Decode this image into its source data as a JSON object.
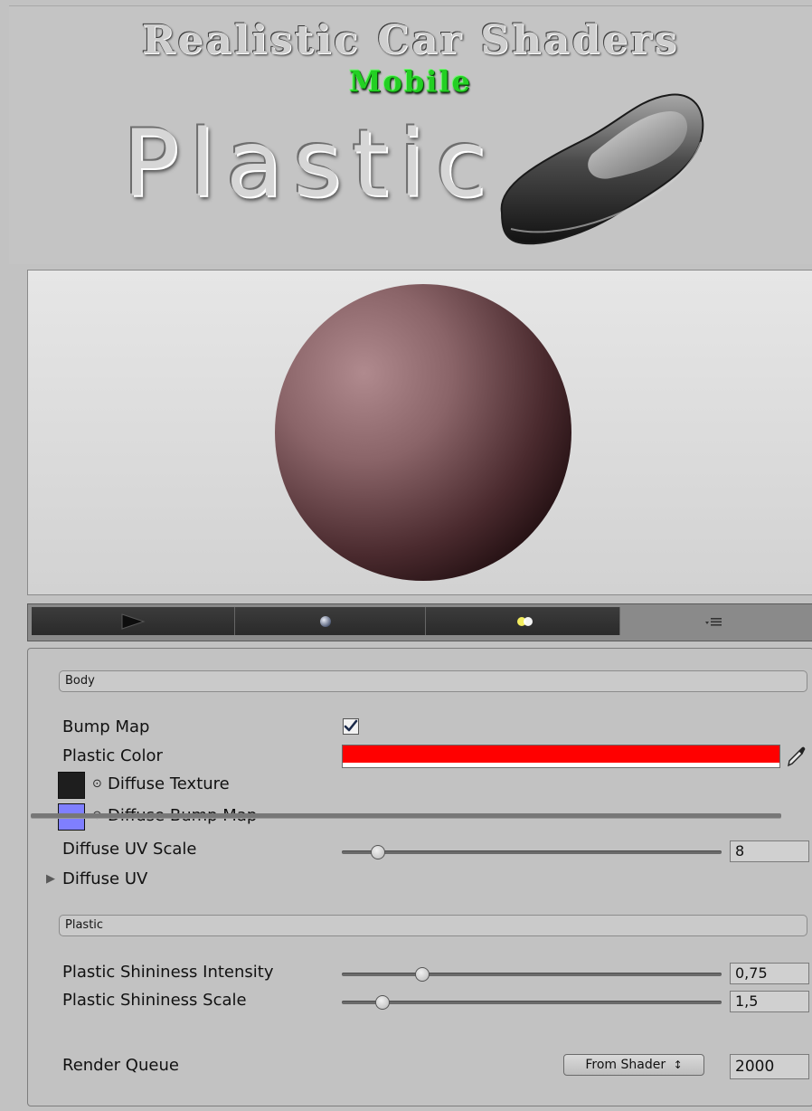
{
  "banner": {
    "title": "Realistic Car Shaders",
    "subtitle": "Mobile",
    "material_name": "Plastic",
    "icon": "car-body-icon"
  },
  "preview": {
    "sphere_colors": [
      "#b08a8e",
      "#4a2a2e",
      "#0d0506"
    ]
  },
  "toolbar": {
    "icons": [
      "play-icon",
      "sphere-icon",
      "light-icon",
      "menu-icon"
    ]
  },
  "sections": {
    "body": {
      "label": "Body",
      "bump_map": {
        "label": "Bump Map",
        "checked": true
      },
      "plastic_color": {
        "label": "Plastic Color",
        "value": "#ff0000"
      },
      "diffuse_texture": {
        "label": "Diffuse Texture",
        "swatch": "#1e1e1e"
      },
      "diffuse_bump_map": {
        "label": "Diffuse Bump Map",
        "swatch": "#7f7fff"
      },
      "diffuse_uv_scale": {
        "label": "Diffuse UV Scale",
        "value": "8",
        "fraction": 0.08
      },
      "diffuse_uv": {
        "label": "Diffuse UV"
      }
    },
    "plastic": {
      "label": "Plastic",
      "shininess_intensity": {
        "label": "Plastic Shininess Intensity",
        "value": "0,75",
        "fraction": 0.2
      },
      "shininess_scale": {
        "label": "Plastic Shininess Scale",
        "value": "1,5",
        "fraction": 0.09
      }
    }
  },
  "render_queue": {
    "label": "Render Queue",
    "mode": "From Shader",
    "dropdown_glyph": "↕",
    "value": "2000"
  }
}
